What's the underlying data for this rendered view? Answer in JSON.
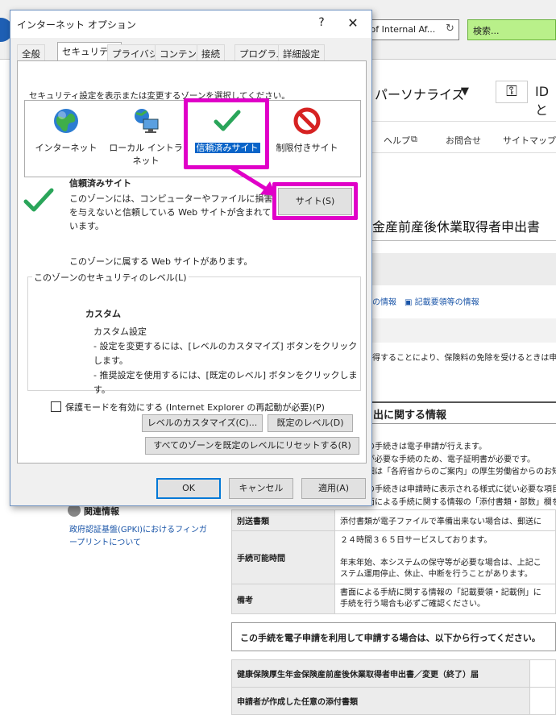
{
  "background": {
    "url_text": "ry of Internal Af...",
    "search_placeholder": "検索...",
    "personalize": "パーソナライズ",
    "id_label": "IDと",
    "nav": {
      "help": "ヘルプ",
      "contact": "お問合せ",
      "sitemap": "サイトマップ"
    },
    "page_title": "金産前産後休業取得者申出書",
    "links": "の情報　▣ 記載要領等の情報",
    "text1": "得することにより、保険料の免除を受けるときは申出が",
    "section_title": "出に関する情報",
    "lines": [
      "の手続きは電子申請が行えます。",
      "が必要な手続のため、電子証明書が必要です。",
      "細は「各府省からのご案内」の厚生労働省からのお知",
      "の手続きは申請時に表示される様式に従い必要な項目を",
      "面による手続に関する情報の「添付書類・部数」欄を"
    ],
    "related_title": "関連情報",
    "related_link": "政府認証基盤(GPKI)におけるフィンガープリントについて",
    "table": [
      {
        "header": "別送書類",
        "value": "添付書類が電子ファイルで準備出来ない場合は、郵送に"
      },
      {
        "header": "手続可能時間",
        "value": "２４時間３６５日サービスしております。\n\n年末年始、本システムの保守等が必要な場合は、上記こ\nステム運用停止、休止、中断を行うことがあります。"
      },
      {
        "header": "備考",
        "value": "書面による手続に関する情報の「記載要領・記載例」に\n手続を行う場合も必ずご確認ください。"
      }
    ],
    "notice": "この手続を電子申請を利用して申請する場合は、以下から行ってください。",
    "table2": [
      {
        "header": "健康保険厚生年金保険産前産後休業取得者申出書／変更（終了）届"
      },
      {
        "header": "申請者が作成した任意の添付書類"
      }
    ]
  },
  "dialog": {
    "title": "インターネット オプション",
    "help": "?",
    "close": "✕",
    "tabs": [
      "全般",
      "セキュリティ",
      "プライバシー",
      "コンテンツ",
      "接続",
      "プログラム",
      "詳細設定"
    ],
    "active_tab": "セキュリティ",
    "zone_prompt": "セキュリティ設定を表示または変更するゾーンを選択してください。",
    "zones": [
      "インターネット",
      "ローカル イントラネット",
      "信頼済みサイト",
      "制限付きサイト"
    ],
    "selected_zone": "信頼済みサイト",
    "selected_desc": "このゾーンには、コンピューターやファイルに損害を与えないと信頼している Web サイトが含まれています。",
    "sites_button": "サイト(S)",
    "zone_note": "このゾーンに属する Web サイトがあります。",
    "level_caption": "このゾーンのセキュリティのレベル(L)",
    "level_name": "カスタム",
    "level_desc": "カスタム設定\n- 設定を変更するには、[レベルのカスタマイズ] ボタンをクリックします。\n- 推奨設定を使用するには、[既定のレベル] ボタンをクリックします。",
    "protected_mode": "保護モードを有効にする (Internet Explorer の再起動が必要)(P)",
    "custom_level_button": "レベルのカスタマイズ(C)...",
    "default_level_button": "既定のレベル(D)",
    "reset_all_button": "すべてのゾーンを既定のレベルにリセットする(R)",
    "ok": "OK",
    "cancel": "キャンセル",
    "apply": "適用(A)"
  },
  "colors": {
    "highlight": "#e000c8",
    "accent_selected": "#0a64c8",
    "search_bg": "#b9f08a",
    "check_green": "#2aa55a"
  }
}
